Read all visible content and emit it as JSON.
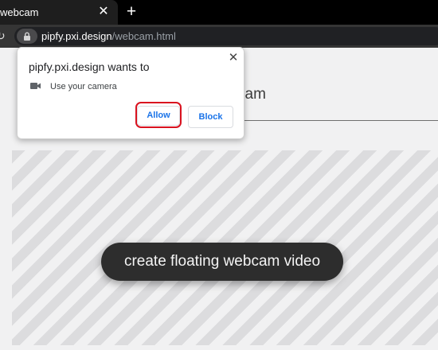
{
  "browser": {
    "tab": {
      "title": "webcam",
      "close_glyph": "✕"
    },
    "new_tab_glyph": "+",
    "reload_glyph": "↻",
    "address": {
      "host": "pipfy.pxi.design",
      "path": "/webcam.html"
    }
  },
  "page": {
    "heading": "cam",
    "create_button_label": "create floating webcam video"
  },
  "permission_popup": {
    "title": "pipfy.pxi.design wants to",
    "close_glyph": "✕",
    "permission_label": "Use your camera",
    "allow_label": "Allow",
    "block_label": "Block"
  },
  "icons": {
    "lock": "lock-icon",
    "camera": "camera-icon",
    "reload": "reload-icon"
  },
  "colors": {
    "button_text": "#1a73e8",
    "highlight": "#d9121f",
    "create_button_bg": "#2d2d2d"
  }
}
